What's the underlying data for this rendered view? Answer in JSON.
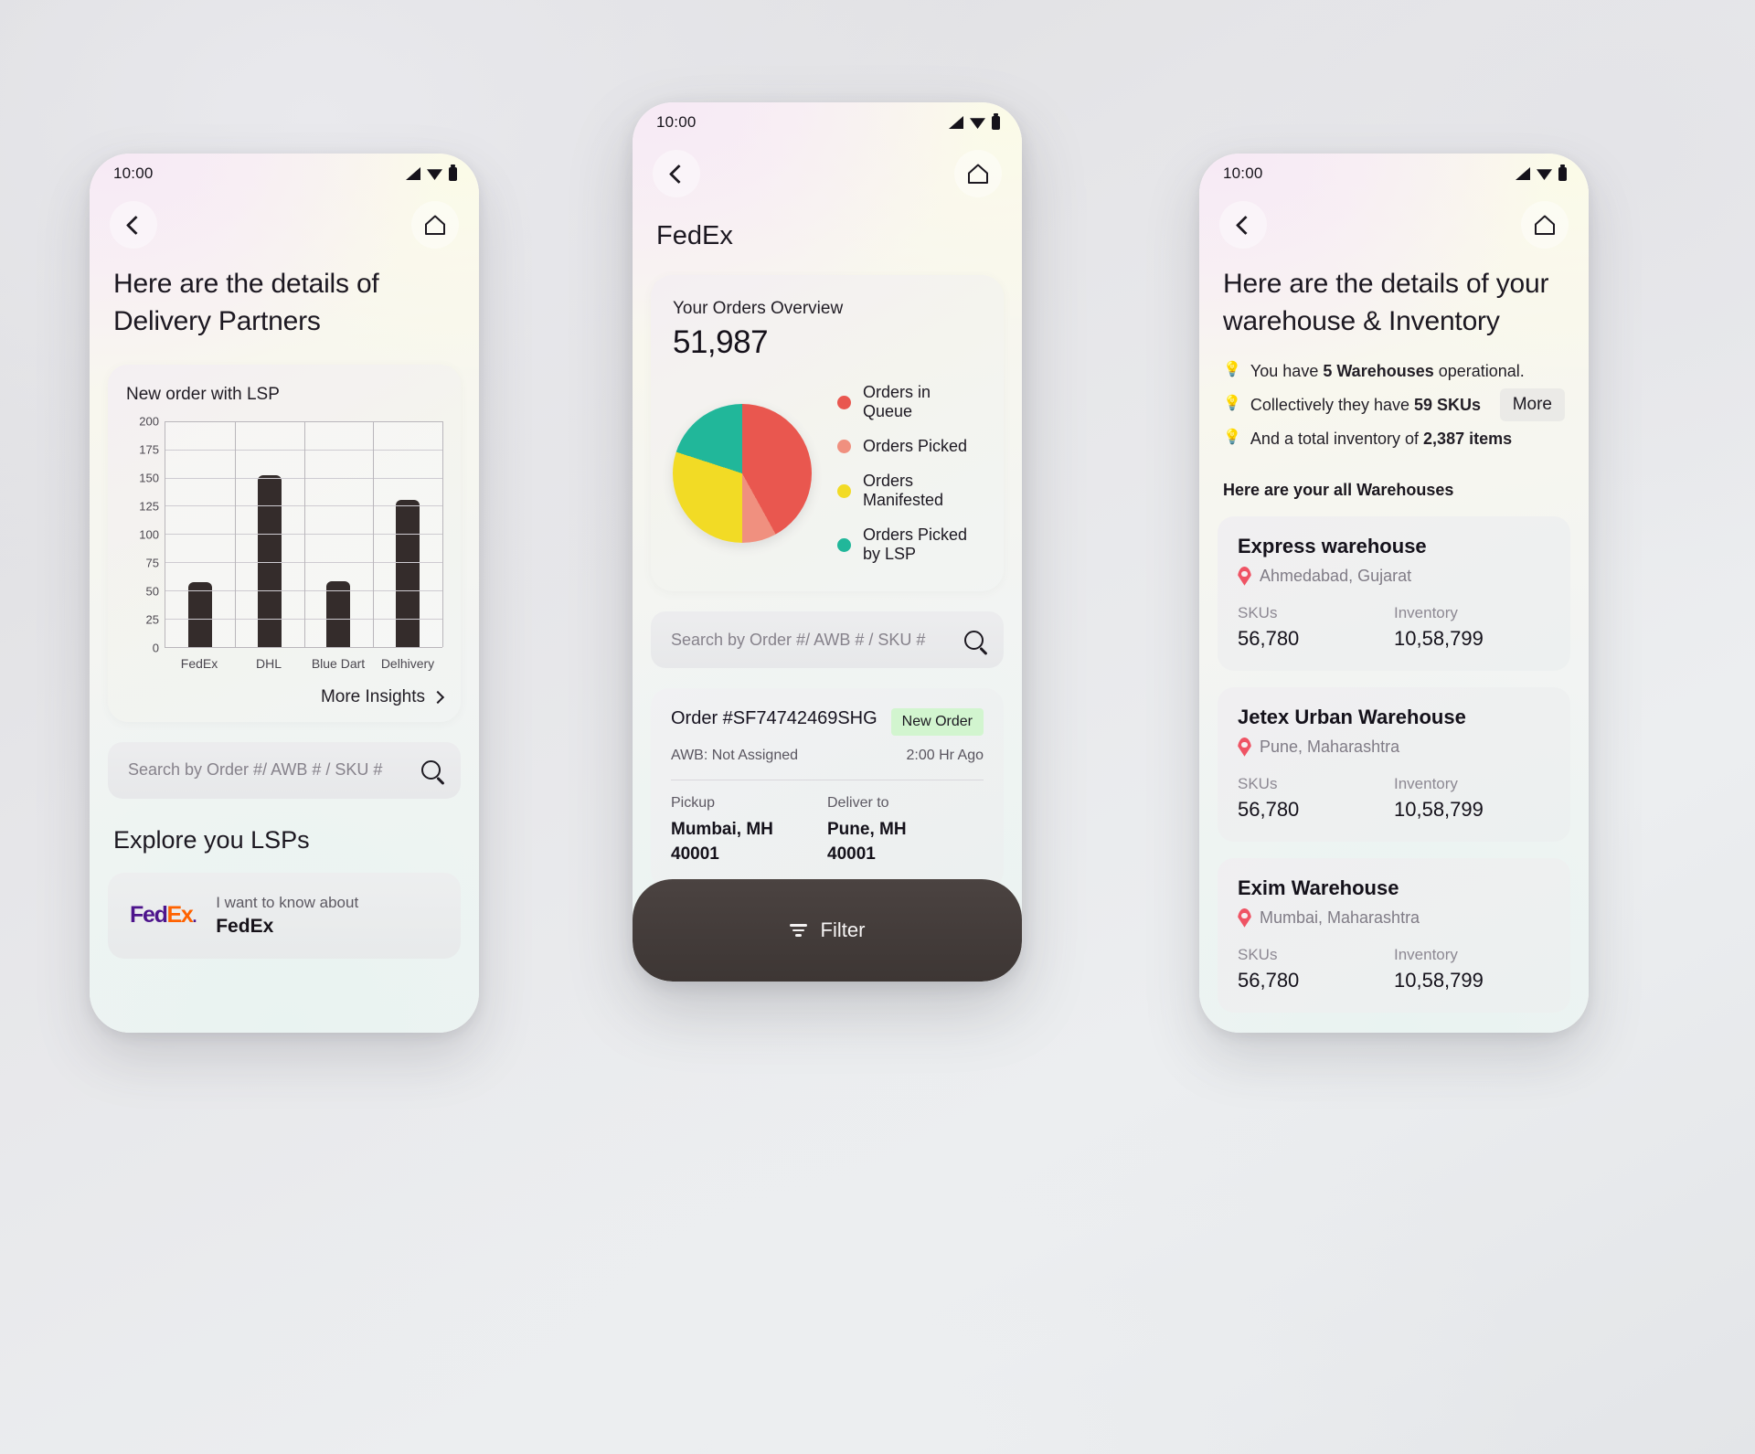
{
  "statusbar": {
    "time": "10:00",
    "signal_icon": "signal-icon",
    "wifi_icon": "wifi-icon",
    "battery_icon": "battery-icon"
  },
  "screen_delivery_partners": {
    "heading": "Here are the details of Delivery Partners",
    "chart_card_title": "New order with LSP",
    "more_insights": "More Insights",
    "search": {
      "placeholder": "Search by Order #/ AWB # / SKU #",
      "value": ""
    },
    "explore_heading": "Explore you LSPs",
    "lsp_card": {
      "logo_fed": "Fed",
      "logo_ex": "Ex",
      "logo_dot": ".",
      "subtitle": "I want to know about",
      "name": "FedEx"
    }
  },
  "screen_fedex": {
    "title": "FedEx",
    "overview_label": "Your Orders Overview",
    "overview_value": "51,987",
    "search": {
      "placeholder": "Search by Order #/ AWB # / SKU #",
      "value": ""
    },
    "order": {
      "id": "Order #SF74742469SHG",
      "badge": "New Order",
      "awb": "AWB: Not Assigned",
      "time": "2:00 Hr Ago",
      "pickup_label": "Pickup",
      "pickup_city": "Mumbai, MH",
      "pickup_pin": "40001",
      "deliver_label": "Deliver to",
      "deliver_city": "Pune, MH",
      "deliver_pin": "40001"
    },
    "filter_label": "Filter"
  },
  "screen_warehouse": {
    "heading": "Here are the details of your warehouse & Inventory",
    "bullets": [
      {
        "icon": "💡",
        "html": "You have <b>5 Warehouses</b> operational.",
        "text": "You have 5 Warehouses operational."
      },
      {
        "icon": "💡",
        "html": "Collectively they have <b>59 SKUs</b>",
        "text": "Collectively they have 59 SKUs"
      },
      {
        "icon": "💡",
        "html": "And a total inventory of <b>2,387 items</b>",
        "text": "And a total inventory of 2,387 items"
      }
    ],
    "more_label": "More",
    "list_heading": "Here are your all Warehouses",
    "col_skus": "SKUs",
    "col_inventory": "Inventory",
    "warehouses": [
      {
        "name": "Express warehouse",
        "location": "Ahmedabad, Gujarat",
        "skus": "56,780",
        "inventory": "10,58,799"
      },
      {
        "name": "Jetex Urban Warehouse",
        "location": "Pune, Maharashtra",
        "skus": "56,780",
        "inventory": "10,58,799"
      },
      {
        "name": "Exim Warehouse",
        "location": "Mumbai, Maharashtra",
        "skus": "56,780",
        "inventory": "10,58,799"
      }
    ]
  },
  "colors": {
    "bar": "#342c2b",
    "pie_queue": "#e9574f",
    "pie_picked": "#f0907f",
    "pie_manifested": "#f2db25",
    "pie_picked_lsp": "#21b79a",
    "badge_bg": "#d2f5cf",
    "pin": "#ef5364",
    "fedex_purple": "#4d148c",
    "fedex_orange": "#ff6200"
  },
  "chart_data": [
    {
      "type": "bar",
      "title": "New order with LSP",
      "categories": [
        "FedEx",
        "DHL",
        "Blue Dart",
        "Delhivery"
      ],
      "values": [
        57,
        152,
        58,
        130
      ],
      "xlabel": "",
      "ylabel": "",
      "ylim": [
        0,
        200
      ],
      "yticks": [
        0,
        25,
        50,
        75,
        100,
        125,
        150,
        175,
        200
      ],
      "ytick_labels": [
        "0",
        "25",
        "50",
        "75",
        "100",
        "125",
        "150",
        "175",
        "200"
      ],
      "grid": true,
      "legend": false
    },
    {
      "type": "pie",
      "title": "Your Orders Overview",
      "total": "51,987",
      "labels": [
        "Orders in Queue",
        "Orders Picked",
        "Orders Manifested",
        "Orders Picked by LSP"
      ],
      "values": [
        42,
        8,
        30,
        20
      ],
      "colors": [
        "#e9574f",
        "#f0907f",
        "#f2db25",
        "#21b79a"
      ],
      "legend": true,
      "legend_position": "right"
    }
  ]
}
